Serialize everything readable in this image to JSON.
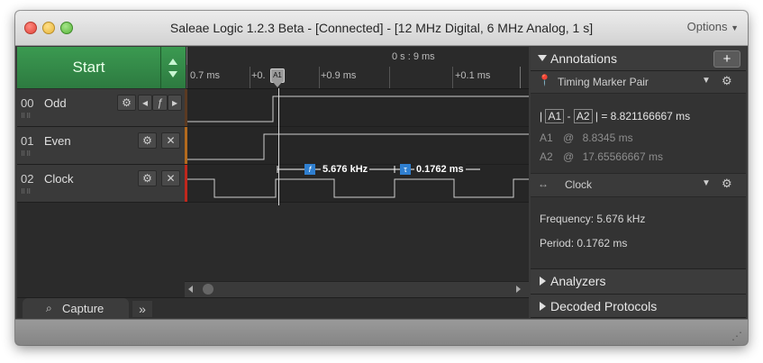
{
  "window": {
    "title": "Saleae Logic 1.2.3 Beta - [Connected] - [12 MHz Digital, 6 MHz Analog, 1 s]",
    "options_label": "Options"
  },
  "controls": {
    "start_label": "Start"
  },
  "ruler": {
    "center_time": "0 s : 9 ms",
    "tick_labels": [
      "0.7 ms",
      "+0.",
      "+0.9 ms",
      "+0.1 ms"
    ],
    "marker_label": "A1"
  },
  "channels": [
    {
      "number": "00",
      "name": "Odd",
      "color": "#6b4a2a"
    },
    {
      "number": "01",
      "name": "Even",
      "color": "#b36a1e"
    },
    {
      "number": "02",
      "name": "Clock",
      "color": "#c0271d"
    }
  ],
  "measurement": {
    "frequency_icon": "f",
    "frequency": "5.676 kHz",
    "period_icon": "τ",
    "period": "0.1762 ms"
  },
  "tabs": {
    "capture_label": "Capture",
    "more_label": "»"
  },
  "annotations": {
    "header": "Annotations",
    "add_label": "+",
    "marker_pair_type": "Timing Marker Pair",
    "delta_prefix": "|",
    "a1_tag": "A1",
    "dash": "-",
    "a2_tag": "A2",
    "delta_suffix": "| = 8.821166667 ms",
    "a1_label": "A1",
    "a1_at": "@",
    "a1_value": "8.8345 ms",
    "a2_label": "A2",
    "a2_at": "@",
    "a2_value": "17.65566667 ms",
    "measure_type": "Clock",
    "frequency_line": "Frequency: 5.676 kHz",
    "period_line": "Period: 0.1762 ms"
  },
  "panels": {
    "analyzers": "Analyzers",
    "decoded_protocols": "Decoded Protocols"
  },
  "colors": {
    "accent_green": "#2f8a45",
    "measure_blue": "#2f7fd0",
    "waveform": "#cfcfcf"
  },
  "icons": [
    "gear-icon",
    "close-icon",
    "pin-icon",
    "plus-icon",
    "resize-grip-icon",
    "capture-icon"
  ]
}
